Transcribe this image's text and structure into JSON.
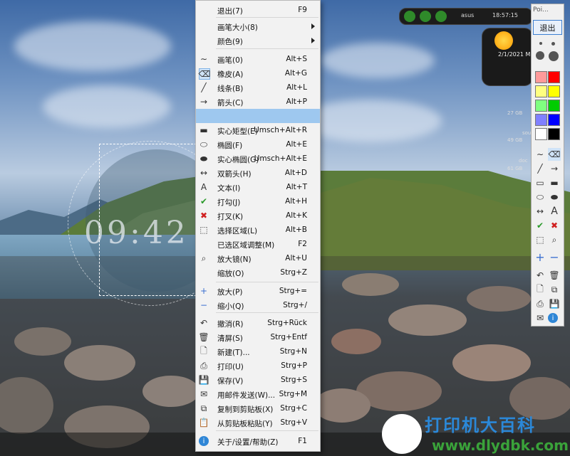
{
  "clock_overlay": {
    "time": "09:42"
  },
  "menu": {
    "items": [
      {
        "label": "退出(7)",
        "shortcut": "F9",
        "icon": "none"
      },
      {
        "label": "画笔大小(8)",
        "shortcut": "",
        "icon": "none",
        "submenu": true
      },
      {
        "label": "颜色(9)",
        "shortcut": "",
        "icon": "none",
        "submenu": true
      },
      {
        "label": "画笔(0)",
        "shortcut": "Alt+S",
        "icon": "pen-icon"
      },
      {
        "label": "橡皮(A)",
        "shortcut": "Alt+G",
        "icon": "eraser-icon"
      },
      {
        "label": "线条(B)",
        "shortcut": "Alt+L",
        "icon": "line-icon"
      },
      {
        "label": "箭头(C)",
        "shortcut": "Alt+P",
        "icon": "arrow-icon"
      },
      {
        "label": "",
        "shortcut": "",
        "icon": "none"
      },
      {
        "label": "实心矩型(E)",
        "shortcut": "Umsch+Alt+R",
        "icon": "filled-rect-icon"
      },
      {
        "label": "椭圆(F)",
        "shortcut": "Alt+E",
        "icon": "ellipse-icon"
      },
      {
        "label": "实心椭圆(G)",
        "shortcut": "Umsch+Alt+E",
        "icon": "filled-ellipse-icon"
      },
      {
        "label": "双箭头(H)",
        "shortcut": "Alt+D",
        "icon": "double-arrow-icon"
      },
      {
        "label": "文本(I)",
        "shortcut": "Alt+T",
        "icon": "text-icon"
      },
      {
        "label": "打勾(J)",
        "shortcut": "Alt+H",
        "icon": "check-icon"
      },
      {
        "label": "打叉(K)",
        "shortcut": "Alt+K",
        "icon": "cross-icon"
      },
      {
        "label": "选择区域(L)",
        "shortcut": "Alt+B",
        "icon": "select-area-icon"
      },
      {
        "label": "已选区域调整(M)",
        "shortcut": "F2",
        "icon": "none"
      },
      {
        "label": "放大镜(N)",
        "shortcut": "Alt+U",
        "icon": "magnifier-icon"
      },
      {
        "label": "缩放(O)",
        "shortcut": "Strg+Z",
        "icon": "none"
      },
      {
        "label": "放大(P)",
        "shortcut": "Strg+=",
        "icon": "zoom-in-icon"
      },
      {
        "label": "缩小(Q)",
        "shortcut": "Strg+/",
        "icon": "zoom-out-icon"
      },
      {
        "label": "撤消(R)",
        "shortcut": "Strg+Rück",
        "icon": "undo-icon"
      },
      {
        "label": "清屏(S)",
        "shortcut": "Strg+Entf",
        "icon": "trash-icon"
      },
      {
        "label": "新建(T)...",
        "shortcut": "Strg+N",
        "icon": "new-file-icon"
      },
      {
        "label": "打印(U)",
        "shortcut": "Strg+P",
        "icon": "printer-icon"
      },
      {
        "label": "保存(V)",
        "shortcut": "Strg+S",
        "icon": "save-icon"
      },
      {
        "label": "用邮件发送(W)...",
        "shortcut": "Strg+M",
        "icon": "mail-icon"
      },
      {
        "label": "复制到剪贴板(X)",
        "shortcut": "Strg+C",
        "icon": "copy-icon"
      },
      {
        "label": "从剪贴板粘贴(Y)",
        "shortcut": "Strg+V",
        "icon": "paste-icon"
      },
      {
        "label": "关于/设置/帮助(Z)",
        "shortcut": "F1",
        "icon": "info-icon"
      }
    ]
  },
  "topbar": {
    "host": "asus",
    "time": "18:57:15"
  },
  "weather": {
    "date": "2/1/2021 M"
  },
  "gauges": [
    {
      "label": "27 GB"
    },
    {
      "label": "sou"
    },
    {
      "label": "49 GB"
    },
    {
      "label": "doc"
    },
    {
      "label": "61 GB"
    }
  ],
  "toolbar": {
    "title": "Poi...",
    "quit_label": "退出",
    "colors": [
      "#ff9a9a",
      "#ff0000",
      "#ffff80",
      "#ffff00",
      "#80ff80",
      "#00cc00",
      "#8080ff",
      "#0000ff",
      "#ffffff",
      "#000000"
    ]
  },
  "watermark": {
    "line1": "打印机大百科",
    "line2": "www.dlydbk.com"
  }
}
